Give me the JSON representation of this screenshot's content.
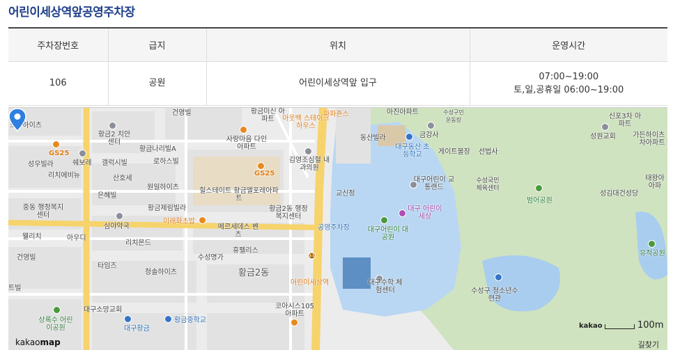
{
  "page": {
    "title": "어린이세상역앞공영주차장"
  },
  "table": {
    "headers": [
      "주차장번호",
      "급지",
      "위치",
      "운영시간"
    ],
    "row": {
      "number": "106",
      "grade": "공원",
      "location": "어린이세상역앞 입구",
      "hours_line1": "07:00~19:00",
      "hours_line2": "토,일,공휴일 06:00~19:00"
    }
  },
  "map": {
    "labels": {
      "l1": "건영빌",
      "l2": "황금미신 아파트",
      "l3": "아웃백 스테이크하우스",
      "l4": "파파존스",
      "l5": "아진아파트",
      "l6": "수성구민 운동장",
      "l7": "신포3차 아파트",
      "l8": "모닝하이츠",
      "l9": "황금2 치안센터",
      "l10": "사랑마음 다인아파트",
      "l11": "동산빌라",
      "l12": "금강사",
      "l13": "성원교회",
      "l14": "가든하이츠 2차아파트",
      "l15": "GS25",
      "l16": "황금나리빌A",
      "l17": "대구동산 초등학교",
      "l18": "게이트볼장",
      "l19": "선법사",
      "l20": "성우빌라",
      "l21": "쉐보레",
      "l22": "갤럭시빌",
      "l23": "로하스빌",
      "l24": "김영조심혈 내과의원",
      "l25": "리치에비뉴",
      "l26": "산호세",
      "l27": "GS25",
      "l28": "대구어린이 교통랜드",
      "l29": "수성국민 체육센터",
      "l30": "태왕아 아파",
      "l31": "원일하이츠",
      "l32": "힐스테이트 황금엘포레아파트",
      "l33": "은혜빌",
      "l34": "교신정",
      "l35": "범어공원",
      "l36": "성김대건성당",
      "l37": "중동 행정복지센터",
      "l38": "황금제림빌라",
      "l39": "황금2동 행정복지센터",
      "l40": "대구 어린이세상",
      "l41": "심야약국",
      "l42": "미래화초밥",
      "l43": "메르세데스 벤츠",
      "l44": "공영주차장",
      "l45": "대구어린이 대공원",
      "l46": "웰리치",
      "l47": "아우디",
      "l48": "리치몬드",
      "l49": "유적공원",
      "l50": "휴펠리스",
      "l51": "건영빌",
      "l52": "수성명가",
      "l53": "타임즈",
      "l54": "청솔하이츠",
      "l55": "황금2동",
      "l56": "어린이세상역",
      "l57": "대구수학 체험센터",
      "l58": "수성구 청소년수련관",
      "l59": "트빌",
      "l60": "대구소망교회",
      "l61": "코아시스105 아파트",
      "l62": "상록수 어린이공원",
      "l63": "대구황금",
      "l64": "황금중학교",
      "l65": "1"
    },
    "scale_brand": "kakao",
    "scale_distance": "100m",
    "footer_logo_light": "kakao",
    "footer_logo_bold": "map",
    "route_link": "길찾기"
  },
  "colors": {
    "title": "#1f3f8a",
    "road_major": "#f6d36b",
    "park": "#cfe3c0",
    "water": "#a9cdef",
    "block": "#e0e0e0"
  },
  "icons": [
    "parking-pin-icon",
    "poi-icon"
  ]
}
